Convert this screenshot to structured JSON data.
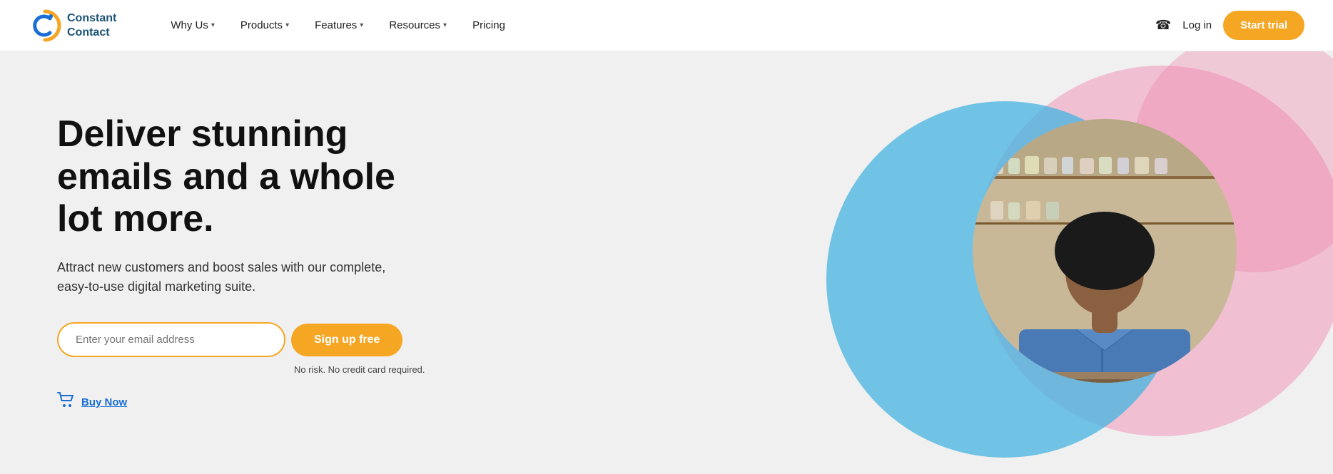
{
  "brand": {
    "name_line1": "Constant",
    "name_line2": "Contact",
    "logo_alt": "Constant Contact Logo"
  },
  "nav": {
    "items": [
      {
        "label": "Why Us",
        "has_dropdown": true
      },
      {
        "label": "Products",
        "has_dropdown": true
      },
      {
        "label": "Features",
        "has_dropdown": true
      },
      {
        "label": "Resources",
        "has_dropdown": true
      },
      {
        "label": "Pricing",
        "has_dropdown": false
      }
    ],
    "phone_icon": "☎",
    "login_label": "Log in",
    "start_trial_label": "Start trial"
  },
  "hero": {
    "headline": "Deliver stunning emails and a whole lot more.",
    "subheadline": "Attract new customers and boost sales with our complete, easy-to-use digital marketing suite.",
    "email_placeholder": "Enter your email address",
    "signup_button": "Sign up free",
    "no_risk_text": "No risk. No credit card required.",
    "buy_now_label": "Buy Now",
    "cart_icon": "🛒"
  },
  "colors": {
    "orange": "#f5a623",
    "blue": "#1a6fd4",
    "pink": "#f082aa",
    "sky_blue": "#50b4e6",
    "dark_text": "#111111",
    "body_text": "#333333"
  }
}
